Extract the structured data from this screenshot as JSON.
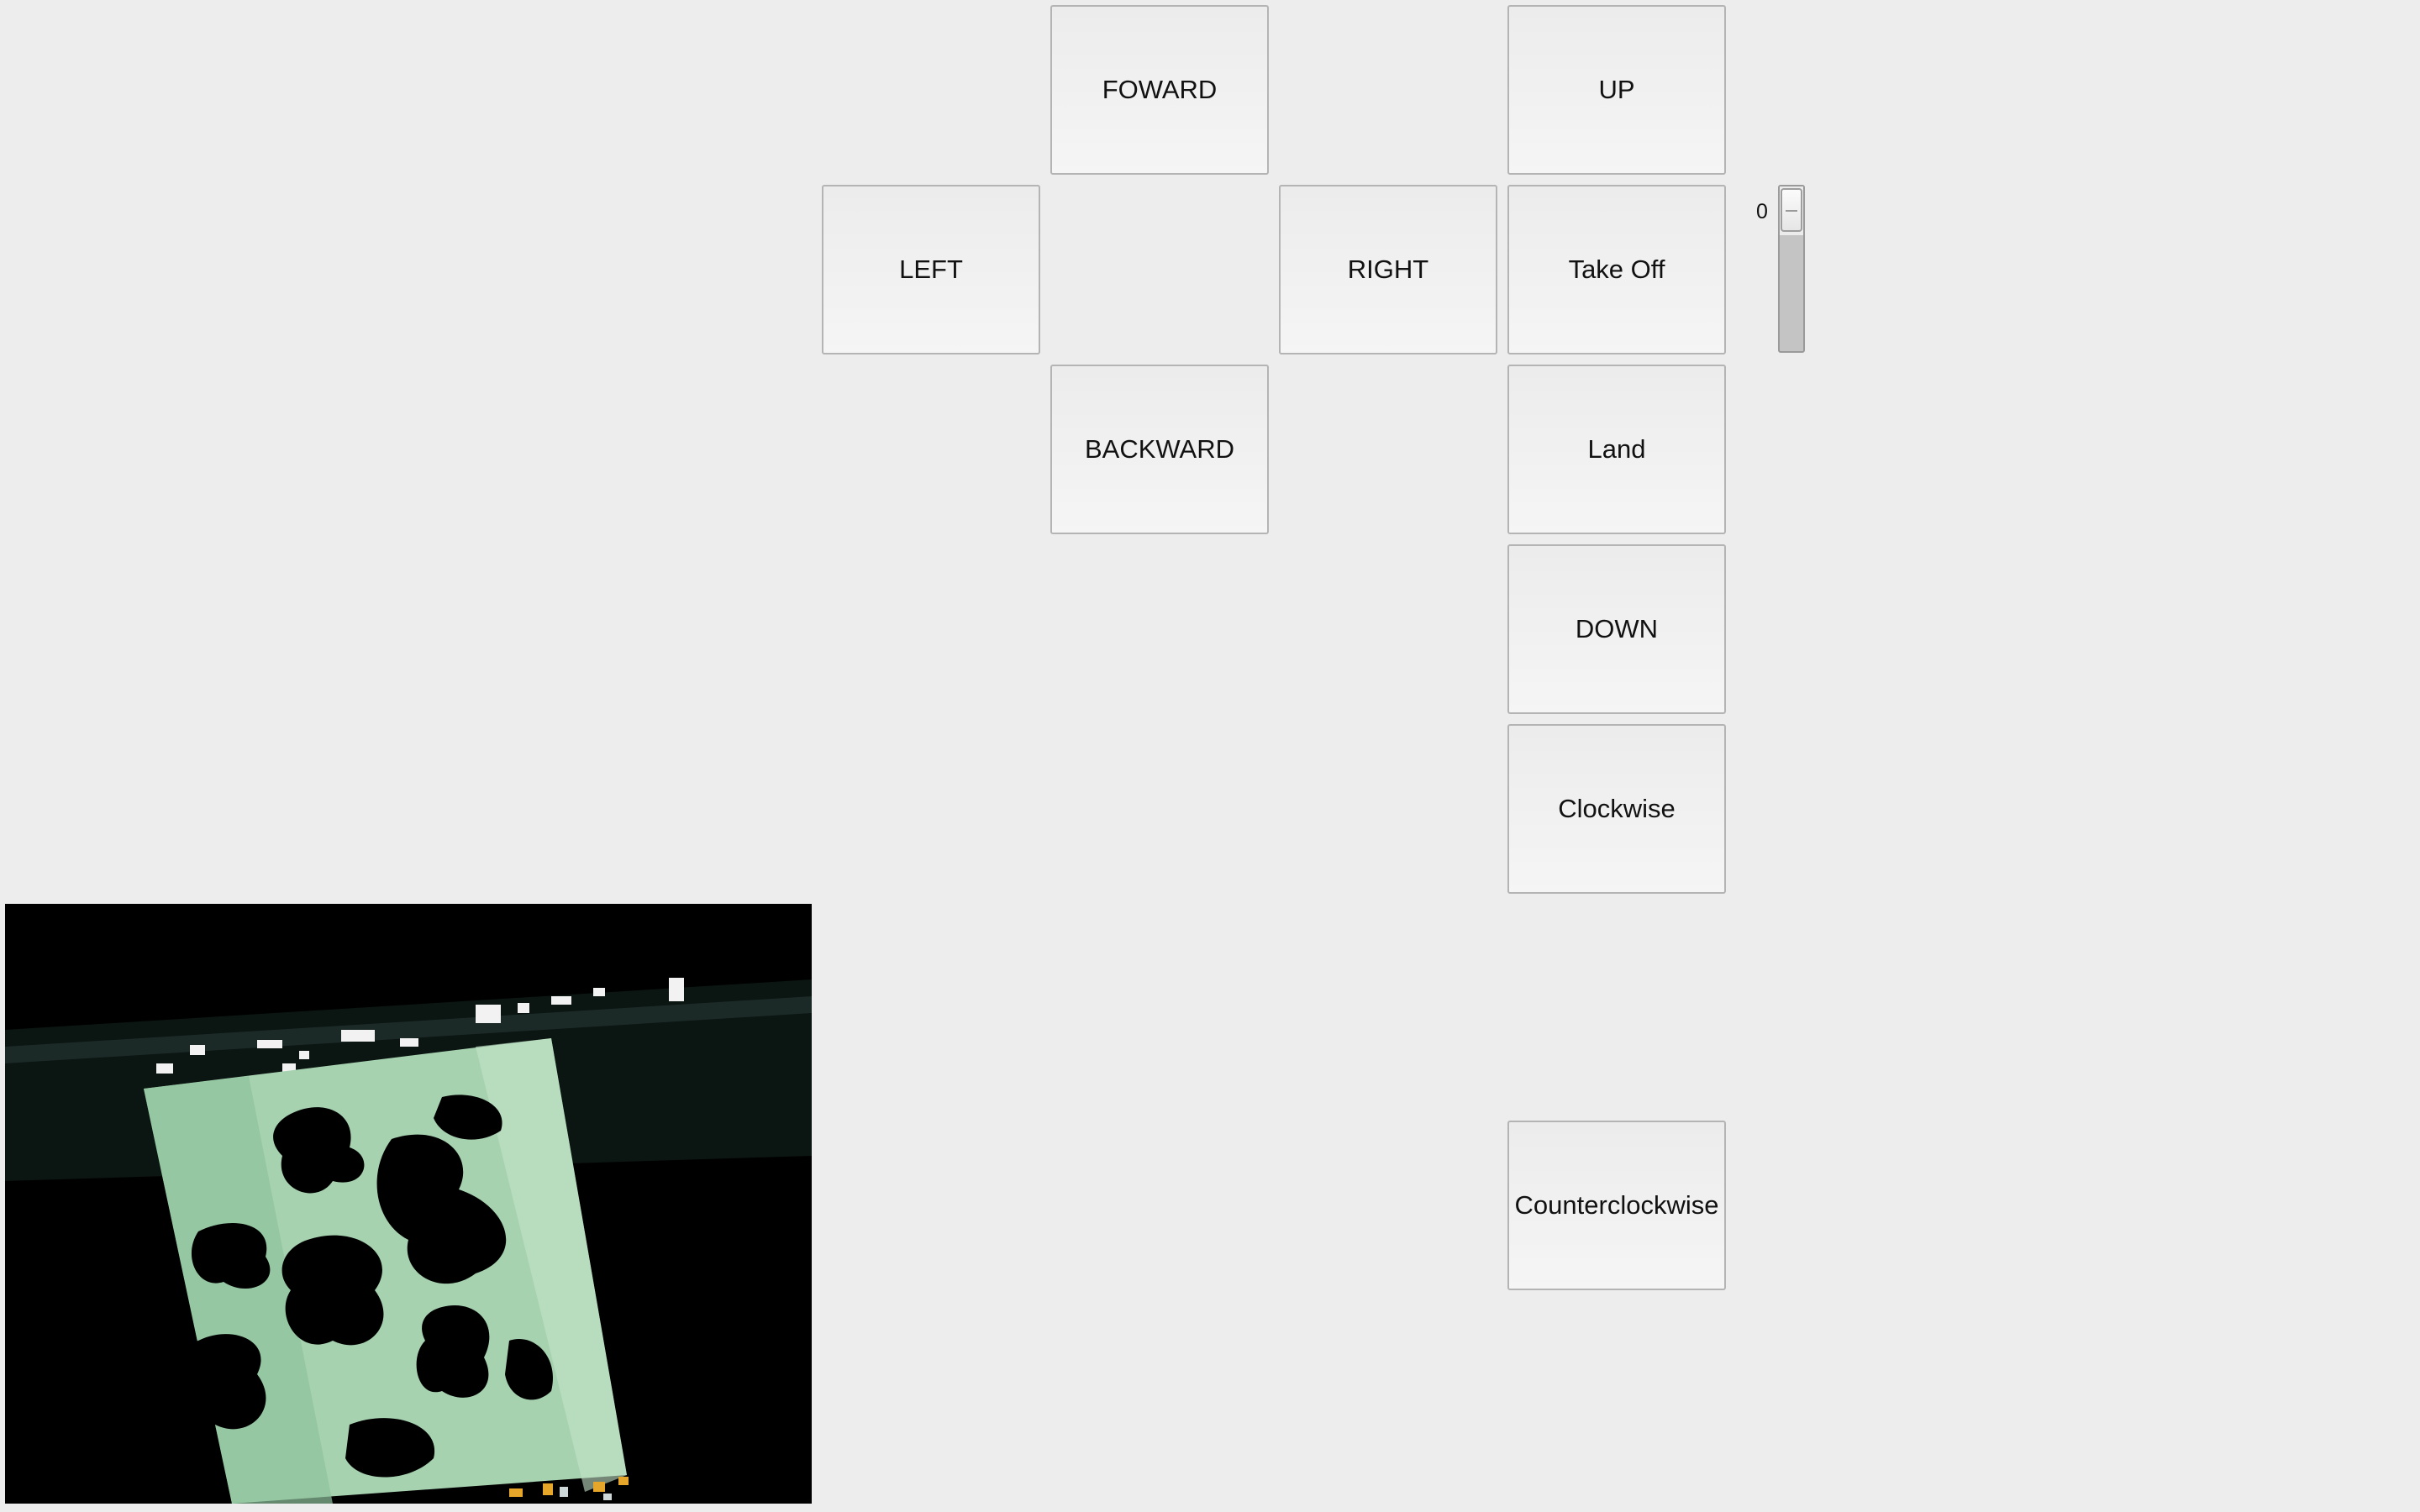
{
  "controls": {
    "forward_label": "FOWARD",
    "up_label": "UP",
    "left_label": "LEFT",
    "right_label": "RIGHT",
    "takeoff_label": "Take Off",
    "backward_label": "BACKWARD",
    "land_label": "Land",
    "down_label": "DOWN",
    "clockwise_label": "Clockwise",
    "counterclockwise_label": "Counterclockwise"
  },
  "speed_slider": {
    "value": "0",
    "orientation": "vertical"
  },
  "camera_feed": {
    "icon": "video-frame"
  },
  "colors": {
    "window_background": "#ededed",
    "button_face": "#f0f0f0",
    "button_border": "#b4b4b4",
    "slider_fill": "#c4c4c4"
  }
}
